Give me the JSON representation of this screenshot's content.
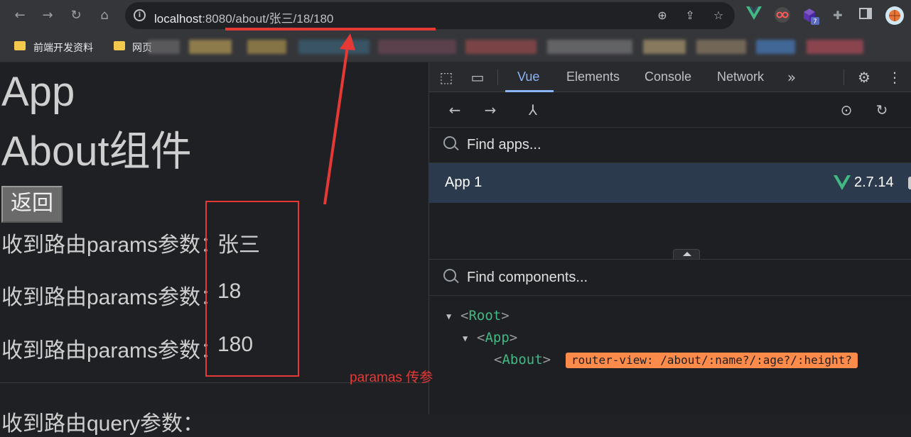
{
  "browser": {
    "url_host": "localhost",
    "url_rest": ":8080/about/张三/18/180",
    "bookmarks": [
      {
        "label": "前端开发资料"
      },
      {
        "label": "网页"
      }
    ],
    "extension_badge": "7"
  },
  "page": {
    "app_heading": "App",
    "about_heading": "About组件",
    "back_button": "返回",
    "params": [
      {
        "label": "收到路由params参数：",
        "value": "张三"
      },
      {
        "label": "收到路由params参数：",
        "value": "18"
      },
      {
        "label": "收到路由params参数：",
        "value": "180"
      }
    ],
    "partial_row": "收到路由query参数："
  },
  "annotation": {
    "label": "paramas 传参",
    "color": "#e53935"
  },
  "devtools": {
    "tabs": [
      {
        "label": "Vue",
        "active": true
      },
      {
        "label": "Elements",
        "active": false
      },
      {
        "label": "Console",
        "active": false
      },
      {
        "label": "Network",
        "active": false
      }
    ],
    "find_apps_placeholder": "Find apps...",
    "find_components_placeholder": "Find components...",
    "app": {
      "name": "App 1",
      "vue_version": "2.7.14"
    },
    "tree": {
      "root": "Root",
      "app": "App",
      "about": "About",
      "router_view": "router-view: /about/:name?/:age?/:height?"
    },
    "colors": {
      "vue_green": "#42b883",
      "accent": "#8ab4f8",
      "router_badge": "#ff8b4a"
    }
  }
}
